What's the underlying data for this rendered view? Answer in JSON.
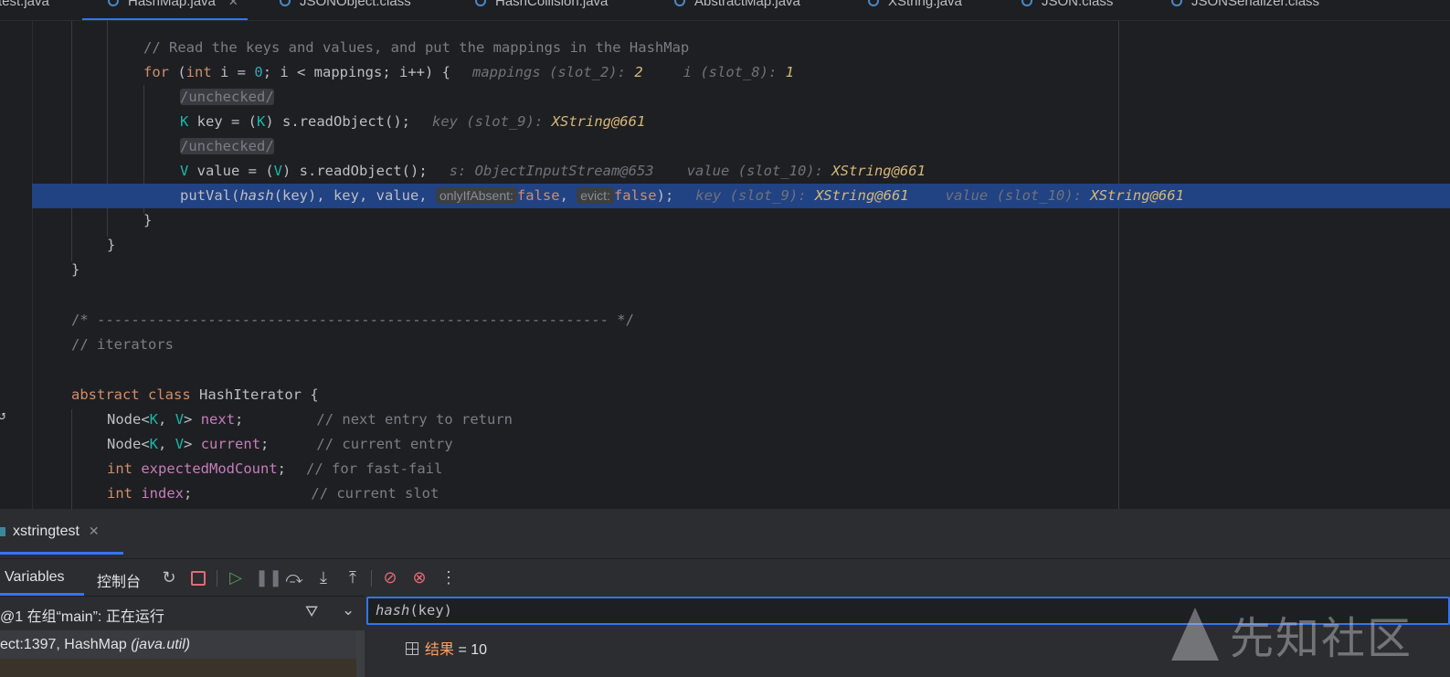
{
  "editor_tabs": [
    "test.java",
    "HashMap.java",
    "JSONObject.class",
    "HashCollision.java",
    "AbstractMap.java",
    "XString.java",
    "JSON.class",
    "JSONSerializer.class"
  ],
  "code": {
    "l1": "// Read the keys and values, and put the mappings in the HashMap",
    "l2_code_a": "for",
    "l2_code_b": " (",
    "l2_code_c": "int",
    "l2_code_d": " i = ",
    "l2_code_e": "0",
    "l2_code_f": "; i < mappings; i++) {",
    "l2_inline_a": "mappings (slot_2):",
    "l2_inline_a_val": "2",
    "l2_inline_b": "i (slot_8):",
    "l2_inline_b_val": "1",
    "unchecked": "/unchecked/",
    "l4_type": "K",
    "l4_a": " key = (",
    "l4_b": "K",
    "l4_c": ") s.readObject();",
    "l4_inline": "key (slot_9):",
    "l4_inline_val": "XString@661",
    "l6_type": "V",
    "l6_a": " value = (",
    "l6_b": "V",
    "l6_c": ") s.readObject();",
    "l6_inline_a": "s: ObjectInputStream@653",
    "l6_inline_b": "value (slot_10):",
    "l6_inline_b_val": "XString@661",
    "l7_a": "putVal(",
    "l7_hash": "hash",
    "l7_b": "(key), key, value, ",
    "l7_hint1": "onlyIfAbsent:",
    "l7_false1": "false",
    "l7_c": ", ",
    "l7_hint2": "evict:",
    "l7_false2": "false",
    "l7_d": ");",
    "l7_inline_a": "key (slot_9):",
    "l7_inline_a_val": "XString@661",
    "l7_inline_b": "value (slot_10):",
    "l7_inline_b_val": "XString@661",
    "brace_close": "}",
    "divider": "/* ------------------------------------------------------------ */",
    "iterators": "// iterators",
    "cls_kw1": "abstract",
    "cls_kw2": "class",
    "cls_name": " HashIterator {",
    "f1_a": "Node<",
    "f1_k": "K",
    "f1_comma": ", ",
    "f1_v": "V",
    "f1_b": "> ",
    "f1_name": "next",
    "f1_c": ";",
    "f1_cm": "// next entry to return",
    "f2_name": "current",
    "f2_cm": "// current entry",
    "f3_type": "int",
    "f3_name": "expectedModCount",
    "f3_cm": "// for fast-fail",
    "f4_name": "index",
    "f4_cm": "// current slot"
  },
  "debug": {
    "session_label": "xstringtest",
    "session_close": "✕",
    "tab_variables": "Variables",
    "tab_console": "控制台",
    "frame_label": "@1 在组“main”: 正在运行",
    "frame_row_a": "ect:1397, HashMap ",
    "frame_row_b": "(java.util)",
    "eval_expr_italic": "hash",
    "eval_expr_rest": "(key)",
    "result_name": "结果",
    "result_value": " = 10"
  },
  "watermark": "先知社区",
  "colors": {
    "highlight": "#214283",
    "accent": "#3574f0"
  }
}
